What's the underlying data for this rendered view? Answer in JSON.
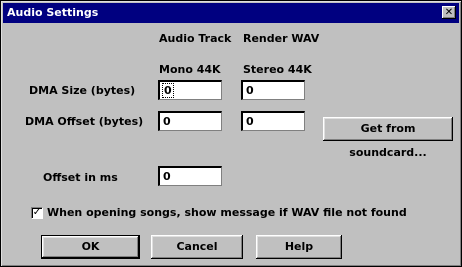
{
  "window": {
    "title": "Audio Settings",
    "close_glyph": "✕"
  },
  "columns": {
    "audio_track": "Audio Track",
    "render_wav": "Render WAV"
  },
  "sub_headers": {
    "mono": "Mono 44K",
    "stereo": "Stereo 44K"
  },
  "rows": {
    "dma_size": {
      "label": "DMA Size (bytes)",
      "audio_value": "0",
      "render_value": "0"
    },
    "dma_offset": {
      "label": "DMA Offset (bytes)",
      "audio_value": "0",
      "render_value": "0"
    },
    "offset_ms": {
      "label": "Offset in ms",
      "value": "0"
    }
  },
  "buttons": {
    "get_from_soundcard": "Get from soundcard...",
    "ok": "OK",
    "cancel": "Cancel",
    "help": "Help"
  },
  "checkbox": {
    "label": "When opening songs, show message if WAV file not found",
    "checked": true,
    "check_glyph": "✓"
  }
}
